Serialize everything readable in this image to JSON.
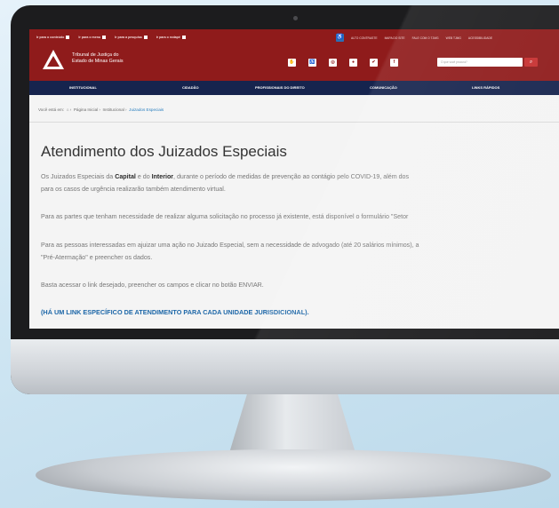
{
  "accessibility": [
    {
      "label": "Ir para o conteúdo"
    },
    {
      "label": "Ir para o menu"
    },
    {
      "label": "Ir para a pesquisa"
    },
    {
      "label": "Ir para o rodapé"
    }
  ],
  "external_links": [
    "ALTO CONTRASTE",
    "MAPA DO SITE",
    "FALE COM O TJMG",
    "WEB TJMG",
    "ACESSIBILIDADE"
  ],
  "brand": {
    "line1": "Tribunal de Justiça do",
    "line2": "Estado de Minas Gerais"
  },
  "search": {
    "placeholder": "O que você procura?"
  },
  "nav": [
    "INSTITUCIONAL",
    "CIDADÃO",
    "PROFISSIONAIS DO DIREITO",
    "COMUNICAÇÃO",
    "LINKS RÁPIDOS"
  ],
  "breadcrumb": {
    "prefix": "Você está em:",
    "home": "Página Inicial",
    "section": "Institucional",
    "current": "Juizados Especiais"
  },
  "page": {
    "title": "Atendimento dos Juizados Especiais",
    "p1a": "Os Juizados Especiais da ",
    "p1_capital": "Capital",
    "p1b": " e do ",
    "p1_interior": "Interior",
    "p1c": ", durante o período de medidas de prevenção ao contágio pelo COVID-19, além dos",
    "p1d": "para os casos de urgência realizarão também atendimento virtual.",
    "p2": "Para as partes que tenham necessidade de realizar alguma solicitação no processo já existente, está disponível o formulário \"Setor",
    "p3a": "Para as pessoas interessadas em ajuizar uma ação no Juizado Especial, sem a necessidade de advogado (até 20 salários mínimos), a",
    "p3b": "\"Pré-Atermação\" e preencher os dados.",
    "p4": "Basta acessar o link desejado, preencher os campos e clicar no botão ENVIAR.",
    "link": "(HÁ UM LINK ESPECÍFICO DE ATENDIMENTO PARA CADA UNIDADE JURISDICIONAL)."
  }
}
